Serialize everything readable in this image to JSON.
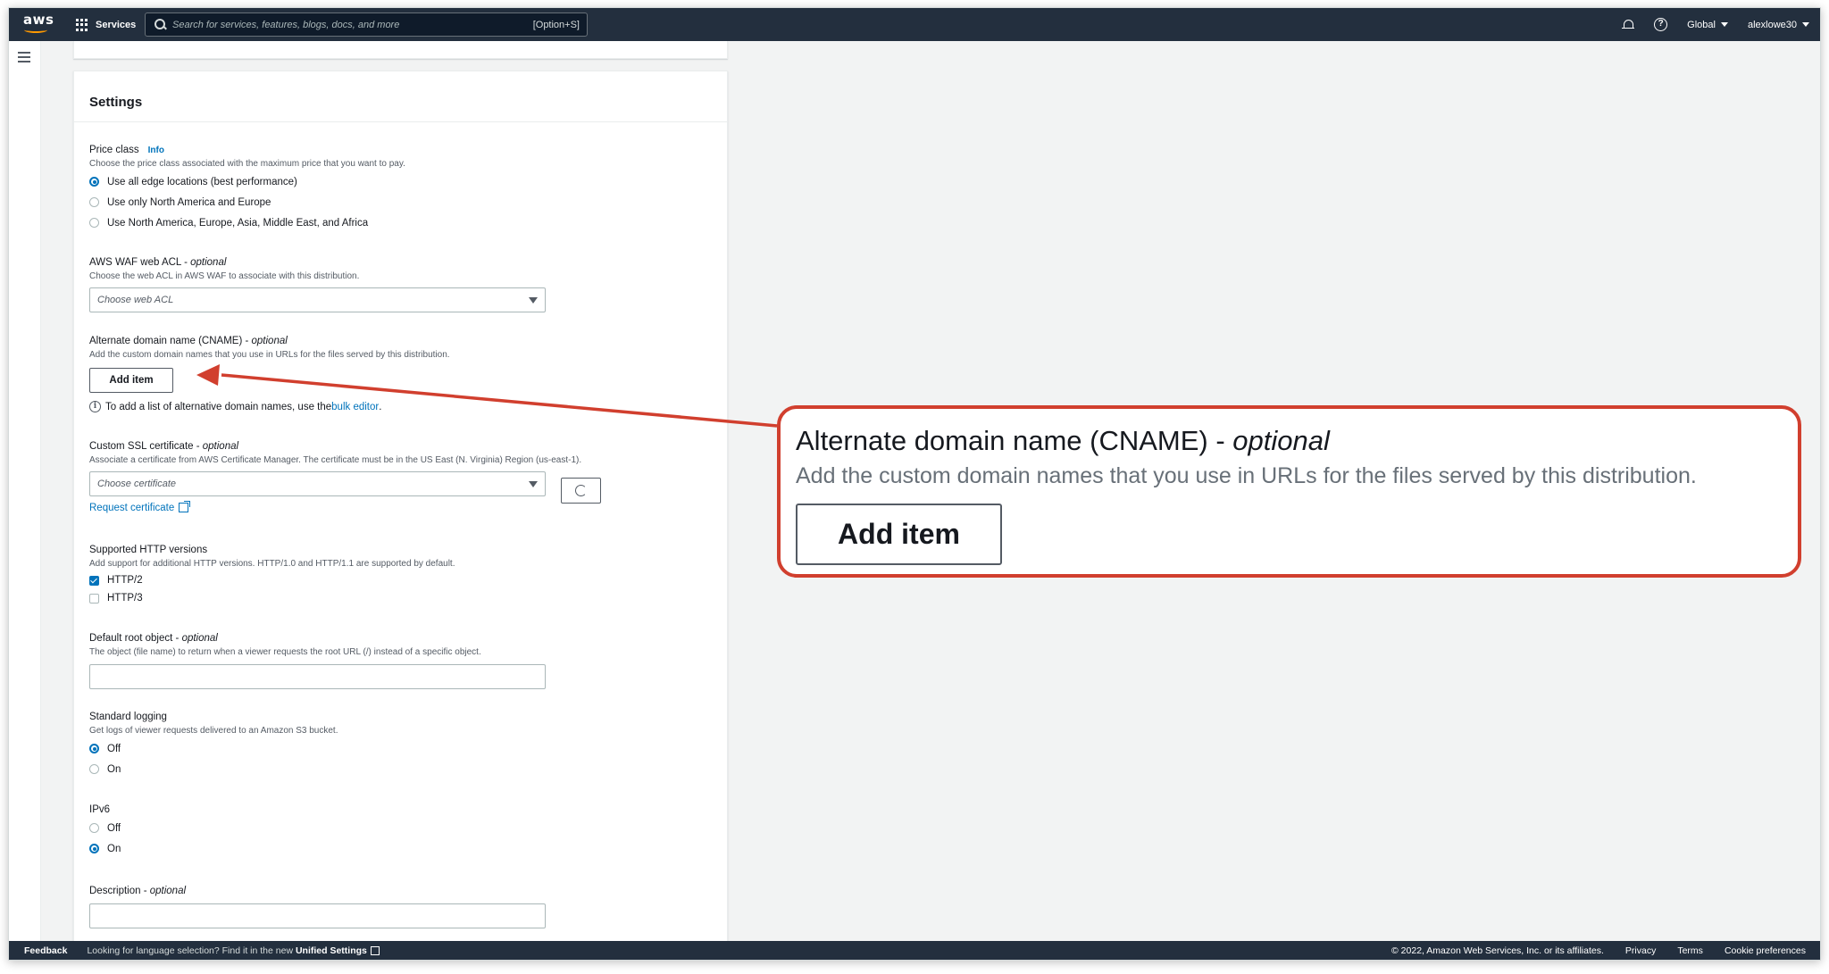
{
  "topnav": {
    "logo_text": "aws",
    "services_label": "Services",
    "search_placeholder": "Search for services, features, blogs, docs, and more",
    "search_shortcut": "[Option+S]",
    "region": "Global",
    "user": "alexlowe30"
  },
  "panel": {
    "title": "Settings",
    "price_class": {
      "label": "Price class",
      "info": "Info",
      "description": "Choose the price class associated with the maximum price that you want to pay.",
      "options": [
        {
          "label": "Use all edge locations (best performance)",
          "selected": true
        },
        {
          "label": "Use only North America and Europe",
          "selected": false
        },
        {
          "label": "Use North America, Europe, Asia, Middle East, and Africa",
          "selected": false
        }
      ]
    },
    "waf": {
      "label": "AWS WAF web ACL - ",
      "label_optional": "optional",
      "description": "Choose the web ACL in AWS WAF to associate with this distribution.",
      "placeholder": "Choose web ACL"
    },
    "cname": {
      "label": "Alternate domain name (CNAME) - ",
      "label_optional": "optional",
      "description": "Add the custom domain names that you use in URLs for the files served by this distribution.",
      "button": "Add item",
      "hint_prefix": "To add a list of alternative domain names, use the ",
      "hint_link": "bulk editor",
      "hint_suffix": "."
    },
    "ssl": {
      "label": "Custom SSL certificate - ",
      "label_optional": "optional",
      "description": "Associate a certificate from AWS Certificate Manager. The certificate must be in the US East (N. Virginia) Region (us-east-1).",
      "placeholder": "Choose certificate",
      "request_link": "Request certificate"
    },
    "http": {
      "label": "Supported HTTP versions",
      "description": "Add support for additional HTTP versions. HTTP/1.0 and HTTP/1.1 are supported by default.",
      "options": [
        {
          "label": "HTTP/2",
          "checked": true
        },
        {
          "label": "HTTP/3",
          "checked": false
        }
      ]
    },
    "root_object": {
      "label": "Default root object - ",
      "label_optional": "optional",
      "description": "The object (file name) to return when a viewer requests the root URL (/) instead of a specific object.",
      "value": ""
    },
    "logging": {
      "label": "Standard logging",
      "description": "Get logs of viewer requests delivered to an Amazon S3 bucket.",
      "options": [
        {
          "label": "Off",
          "selected": true
        },
        {
          "label": "On",
          "selected": false
        }
      ]
    },
    "ipv6": {
      "label": "IPv6",
      "options": [
        {
          "label": "Off",
          "selected": false
        },
        {
          "label": "On",
          "selected": true
        }
      ]
    },
    "description_field": {
      "label": "Description - ",
      "label_optional": "optional",
      "value": ""
    }
  },
  "footer": {
    "feedback": "Feedback",
    "lang_prefix": "Looking for language selection? Find it in the new ",
    "lang_link": "Unified Settings",
    "copyright": "© 2022, Amazon Web Services, Inc. or its affiliates.",
    "privacy": "Privacy",
    "terms": "Terms",
    "cookies": "Cookie preferences"
  },
  "callout": {
    "label": "Alternate domain name (CNAME) - ",
    "label_optional": "optional",
    "description": "Add the custom domain names that you use in URLs for the files served by this distribution.",
    "button": "Add item"
  },
  "colors": {
    "nav_bg": "#232f3e",
    "link": "#0073bb",
    "callout_border": "#d13f2e",
    "arrow": "#d13f2e"
  }
}
